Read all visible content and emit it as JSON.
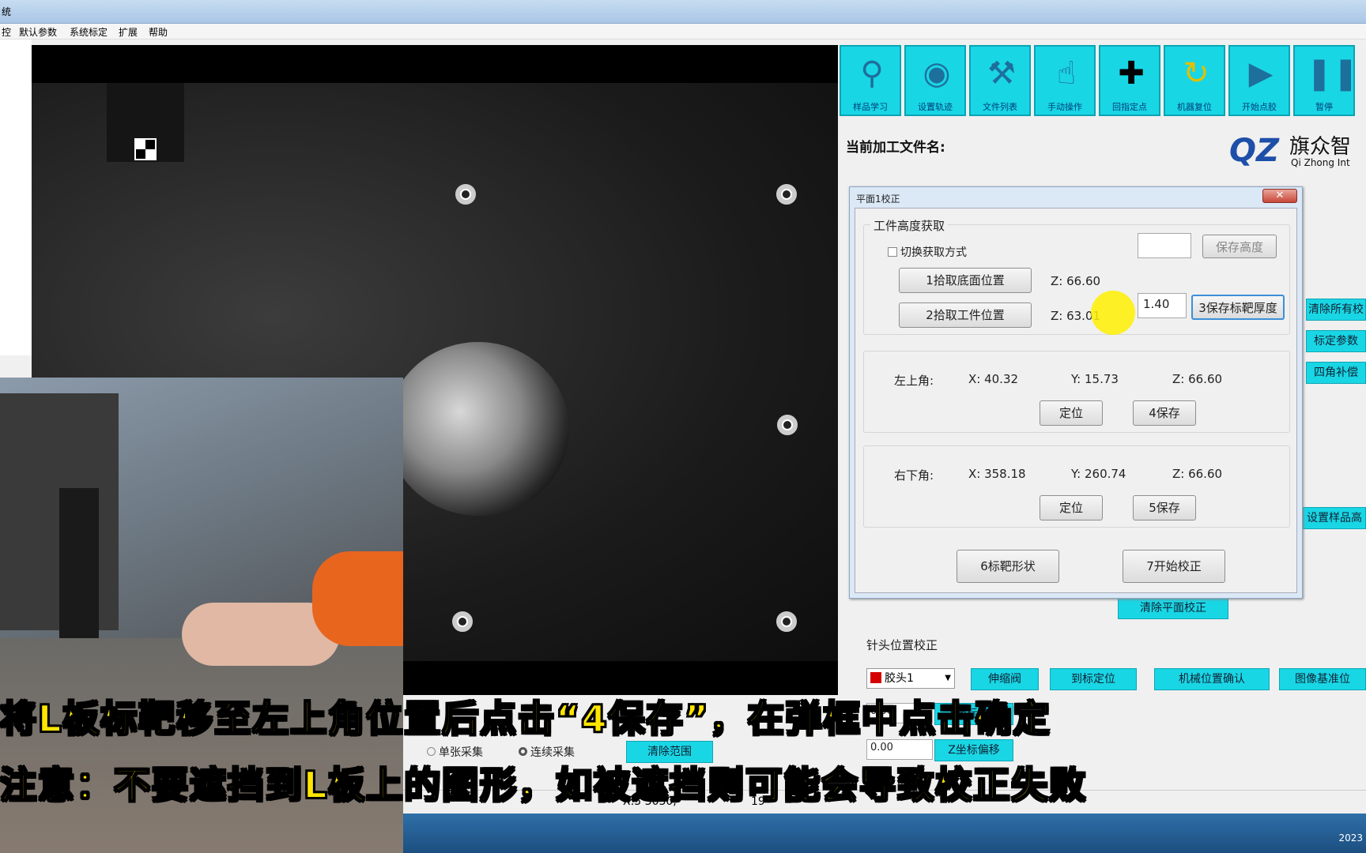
{
  "window": {
    "title": "统"
  },
  "menu": [
    "控",
    "默认参数",
    "系统标定",
    "扩展",
    "帮助"
  ],
  "toolbar": [
    {
      "label": "样品学习",
      "icon": "magnifier-icon"
    },
    {
      "label": "设置轨迹",
      "icon": "route-pin-icon"
    },
    {
      "label": "文件列表",
      "icon": "wrench-screwdriver-icon"
    },
    {
      "label": "手动操作",
      "icon": "hand-pointer-icon"
    },
    {
      "label": "回指定点",
      "icon": "crosshair-icon"
    },
    {
      "label": "机器复位",
      "icon": "reset-clock-icon"
    },
    {
      "label": "开始点胶",
      "icon": "play-icon"
    },
    {
      "label": "暂停",
      "icon": "pause-icon"
    }
  ],
  "current_file_label": "当前加工文件名:",
  "logo": {
    "mark": "QZ",
    "cn": "旗众智",
    "en": "Qi Zhong Int"
  },
  "right_buttons": {
    "clear_all": "清除所有校",
    "calib_params": "标定参数",
    "four_corner": "四角补偿",
    "set_sample_height": "设置样品高",
    "clear_plane": "清除平面校正"
  },
  "dialog": {
    "title": "平面1校正",
    "close": "✕",
    "height_group": {
      "title": "工件高度获取",
      "switch_mode": "切换获取方式",
      "save_height": "保存高度",
      "pick_bottom": "1拾取底面位置",
      "pick_work": "2拾取工件位置",
      "z_bottom": "Z: 66.60",
      "z_work": "Z: 63.01",
      "thickness_value": "1.40",
      "save_thickness": "3保存标靶厚度"
    },
    "top_left": {
      "label": "左上角:",
      "x": "X: 40.32",
      "y": "Y: 15.73",
      "z": "Z: 66.60",
      "locate": "定位",
      "save": "4保存"
    },
    "bottom_right": {
      "label": "右下角:",
      "x": "X: 358.18",
      "y": "Y: 260.74",
      "z": "Z: 66.60",
      "locate": "定位",
      "save": "5保存"
    },
    "target_shape": "6标靶形状",
    "start_calib": "7开始校正"
  },
  "needle": {
    "title": "针头位置校正",
    "glue_select": "胶头1",
    "btn_extend": "伸缩阀",
    "btn_to_mark": "到标定位",
    "btn_mech_confirm": "机械位置确认",
    "btn_image": "图像基准位",
    "x_offset_value": "0.00",
    "x_offset_label": "X坐标偏移",
    "z_offset_value": "0.00",
    "z_offset_label": "Z坐标偏移"
  },
  "capture": {
    "single": "单张采集",
    "continuous": "连续采集",
    "clear_range": "清除范围"
  },
  "status": {
    "coord": "X:5 3030,",
    "mid": "19",
    "time": "2023"
  },
  "subtitles": {
    "line1": "将L板标靶移至左上角位置后点击“4保存”，在弹框中点击确定",
    "line2": "注意：不要遮挡到L板上的图形，如被遮挡则可能会导致校正失败"
  }
}
